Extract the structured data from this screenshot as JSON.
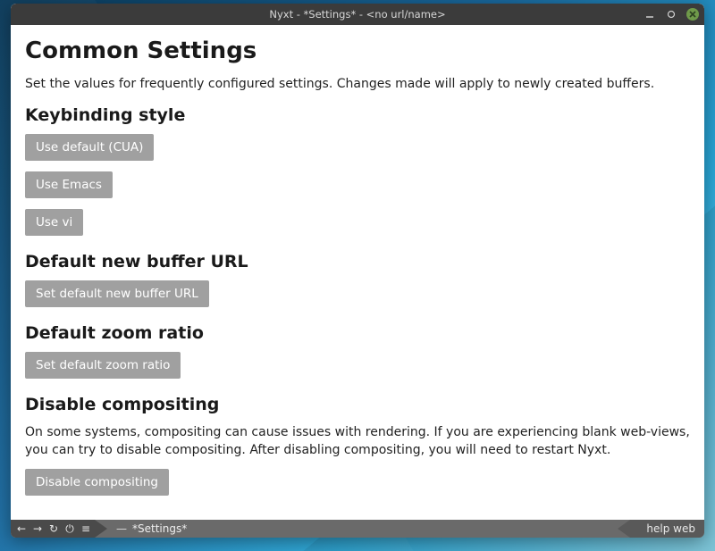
{
  "window": {
    "title": "Nyxt - *Settings* - <no url/name>"
  },
  "page": {
    "heading": "Common Settings",
    "description": "Set the values for frequently configured settings. Changes made will apply to newly created buffers."
  },
  "sections": {
    "keybinding": {
      "title": "Keybinding style",
      "buttons": {
        "cua": "Use default (CUA)",
        "emacs": "Use Emacs",
        "vi": "Use vi"
      }
    },
    "new_buffer_url": {
      "title": "Default new buffer URL",
      "button": "Set default new buffer URL"
    },
    "zoom_ratio": {
      "title": "Default zoom ratio",
      "button": "Set default zoom ratio"
    },
    "compositing": {
      "title": "Disable compositing",
      "paragraph": "On some systems, compositing can cause issues with rendering. If you are experiencing blank web-views, you can try to disable compositing. After disabling compositing, you will need to restart Nyxt.",
      "button": "Disable compositing"
    }
  },
  "statusbar": {
    "buffer_separator": "—",
    "buffer_name": "*Settings*",
    "modes": "help web"
  },
  "icons": {
    "back": "←",
    "forward": "→",
    "reload": "↻",
    "exec": "⏻",
    "menu": "≡"
  }
}
